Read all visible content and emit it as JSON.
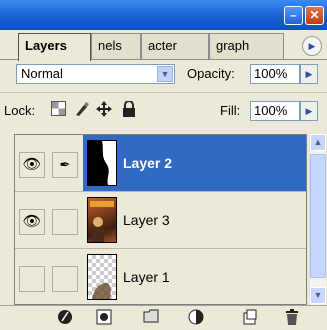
{
  "window": {
    "minimize_glyph": "–",
    "close_glyph": "✕"
  },
  "tabs": [
    {
      "label": "Layers"
    },
    {
      "label": "nels"
    },
    {
      "label": "acter"
    },
    {
      "label": "graph"
    }
  ],
  "tabs_more_glyph": "▶",
  "blend": {
    "mode": "Normal",
    "opacity_label": "Opacity:",
    "opacity_value": "100%"
  },
  "lock": {
    "label": "Lock:",
    "fill_label": "Fill:",
    "fill_value": "100%"
  },
  "layers": [
    {
      "name": "Layer 2",
      "visible": true,
      "brush": true,
      "selected": true
    },
    {
      "name": "Layer 3",
      "visible": true,
      "brush": false,
      "selected": false
    },
    {
      "name": "Layer 1",
      "visible": false,
      "brush": false,
      "selected": false
    }
  ],
  "glyphs": {
    "eye": "👁",
    "brush": "✒",
    "dropdown": "▼",
    "spin": "▶",
    "scroll_up": "▲",
    "scroll_down": "▼"
  },
  "colors": {
    "titlebar": "#0b4fc0",
    "selection": "#316ac5"
  }
}
